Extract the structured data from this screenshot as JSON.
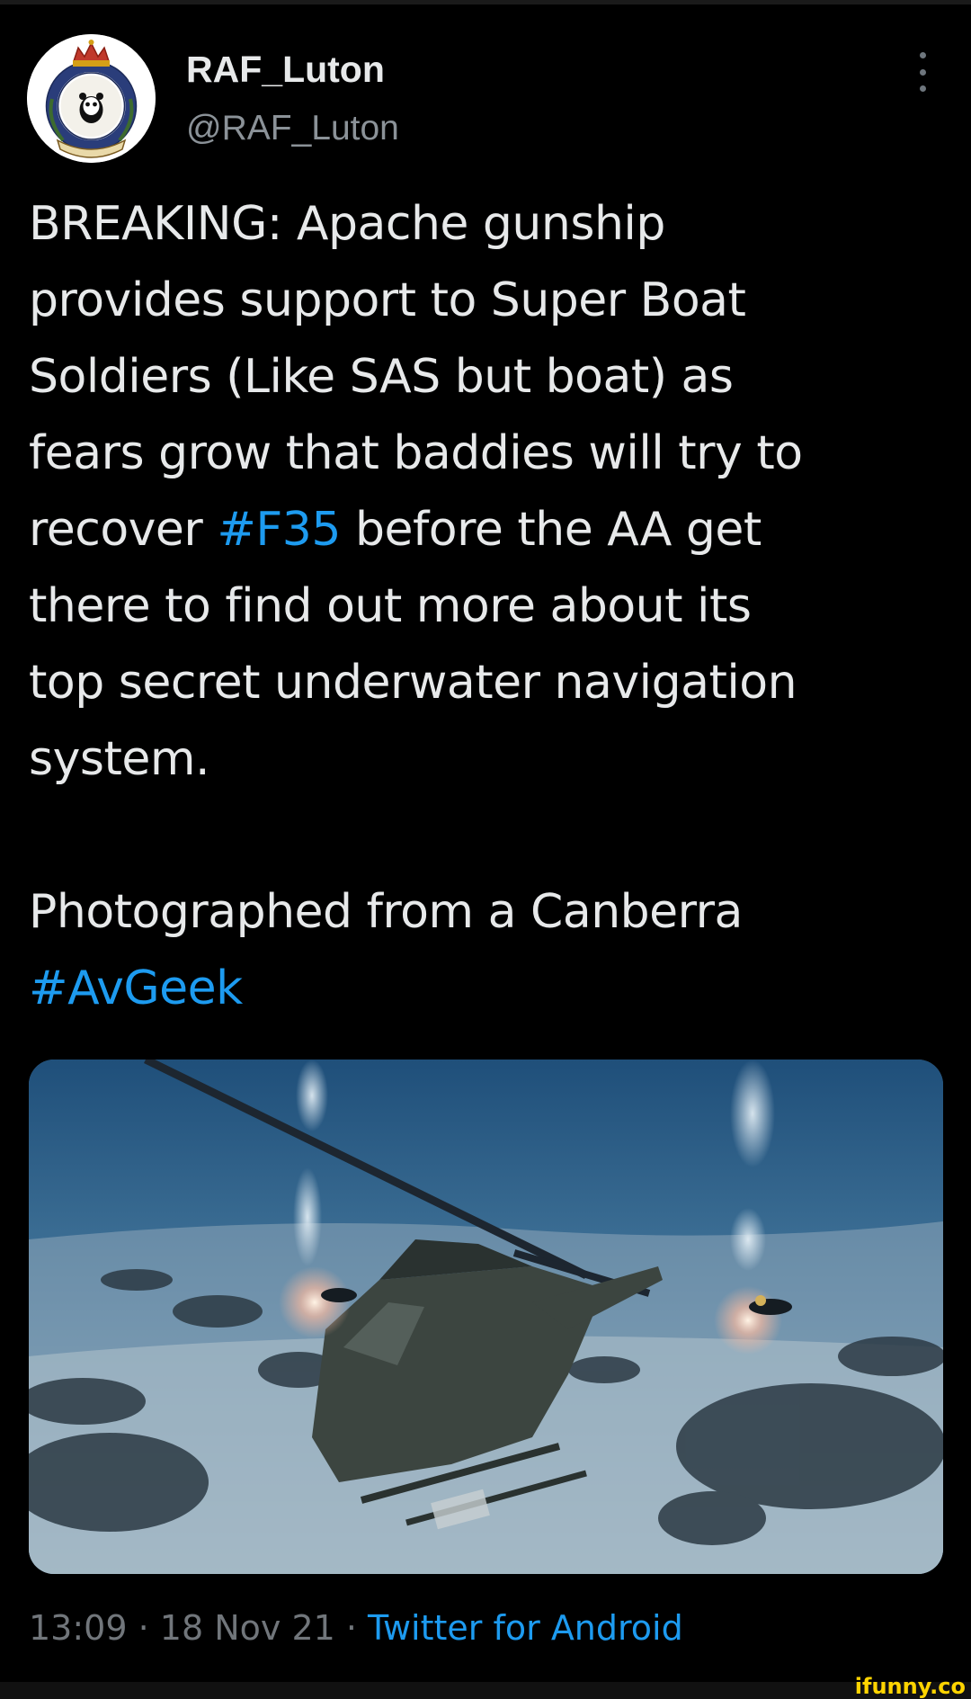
{
  "tweet": {
    "display_name": "RAF_Luton",
    "handle": "@RAF_Luton",
    "text_lines": [
      {
        "parts": [
          {
            "t": "BREAKING: Apache gunship"
          }
        ]
      },
      {
        "parts": [
          {
            "t": "provides support to Super Boat"
          }
        ]
      },
      {
        "parts": [
          {
            "t": "Soldiers (Like SAS but boat) as"
          }
        ]
      },
      {
        "parts": [
          {
            "t": "fears grow that baddies will try to"
          }
        ]
      },
      {
        "parts": [
          {
            "t": "recover "
          },
          {
            "t": "#F35",
            "hashtag": true
          },
          {
            "t": " before the AA get"
          }
        ]
      },
      {
        "parts": [
          {
            "t": "there to find out more about its"
          }
        ]
      },
      {
        "parts": [
          {
            "t": "top secret underwater navigation"
          }
        ]
      },
      {
        "parts": [
          {
            "t": "system."
          }
        ]
      },
      {
        "parts": []
      },
      {
        "parts": [
          {
            "t": "Photographed from a Canberra"
          }
        ]
      },
      {
        "parts": [
          {
            "t": "#AvGeek",
            "hashtag": true
          }
        ]
      }
    ],
    "time": "13:09",
    "date": "18 Nov 21",
    "separator": " · ",
    "source": "Twitter for Android"
  },
  "icons": {
    "avatar": "raf-squadron-crest-icon",
    "more": "more-vertical-icon"
  },
  "colors": {
    "background": "#000000",
    "text": "#e7e9ea",
    "secondary": "#71767b",
    "link": "#1d9bf0"
  },
  "watermark": "ifunny.co"
}
